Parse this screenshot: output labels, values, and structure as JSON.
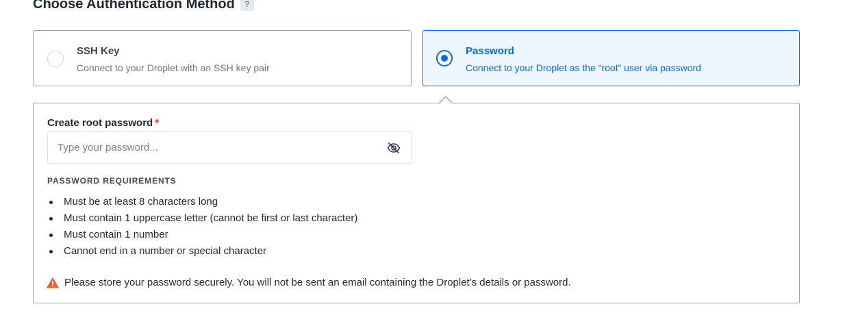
{
  "section": {
    "title": "Choose Authentication Method",
    "help_label": "?"
  },
  "options": [
    {
      "title": "SSH Key",
      "description": "Connect to your Droplet with an SSH key pair",
      "selected": false
    },
    {
      "title": "Password",
      "description": "Connect to your Droplet as the “root” user via password",
      "selected": true
    }
  ],
  "password_panel": {
    "label": "Create root password",
    "required_marker": "*",
    "input_value": "",
    "input_placeholder": "Type your password...",
    "toggle_icon": "eye-slash-icon",
    "requirements_heading": "PASSWORD REQUIREMENTS",
    "requirements": [
      "Must be at least 8 characters long",
      "Must contain 1 uppercase letter (cannot be first or last character)",
      "Must contain 1 number",
      "Cannot end in a number or special character"
    ],
    "warning_icon": "warning-triangle-icon",
    "warning_text": "Please store your password securely. You will not be sent an email containing the Droplet's details or password."
  },
  "colors": {
    "accent": "#0069ff",
    "selected_bg": "#eef6ff",
    "warning": "#e8622c",
    "required": "#d93025"
  }
}
